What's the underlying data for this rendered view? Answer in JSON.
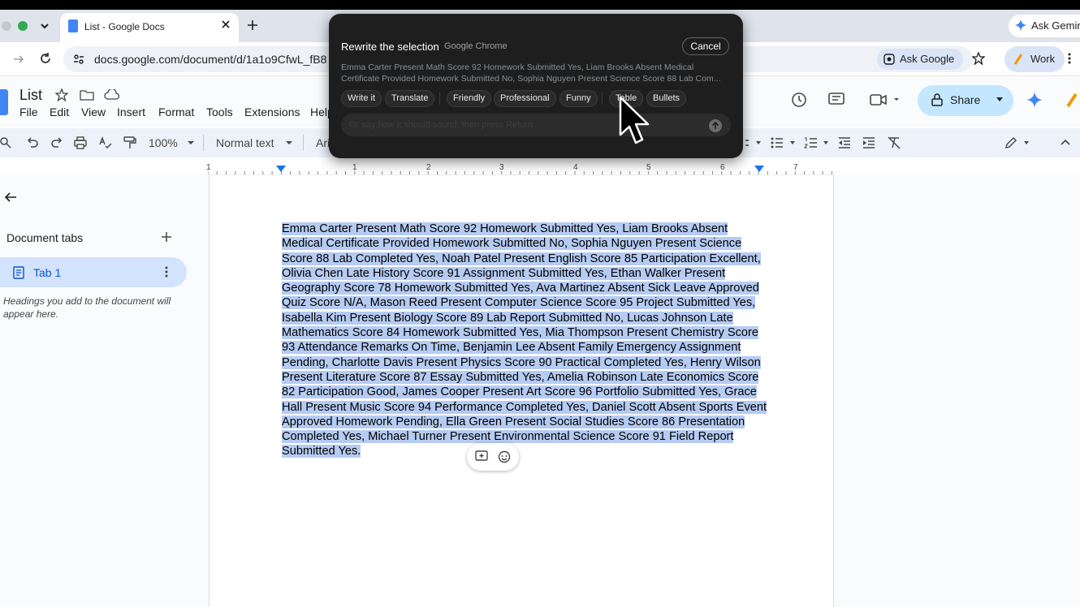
{
  "browser": {
    "tab_title": "List - Google Docs",
    "url": "docs.google.com/document/d/1a1o9CfwL_fB8",
    "ask_gemini": "Ask Gemin",
    "ask_google": "Ask Google",
    "profile": "Work"
  },
  "docs": {
    "title": "List",
    "menu": [
      "File",
      "Edit",
      "View",
      "Insert",
      "Format",
      "Tools",
      "Extensions",
      "Help"
    ],
    "share_label": "Share",
    "toolbar": {
      "zoom": "100%",
      "style": "Normal text",
      "font": "Ari"
    },
    "ruler_numbers": [
      "1",
      "1",
      "2",
      "3",
      "4",
      "5",
      "6",
      "7"
    ]
  },
  "sidebar": {
    "heading": "Document tabs",
    "tab_label": "Tab 1",
    "hint": "Headings you add to the document will appear here."
  },
  "document": {
    "body": "Emma Carter Present Math Score 92 Homework Submitted Yes, Liam Brooks Absent Medical Certificate Provided Homework Submitted No, Sophia Nguyen Present Science Score 88 Lab Completed Yes, Noah Patel Present English Score 85 Participation Excellent, Olivia Chen Late History Score 91 Assignment Submitted Yes, Ethan Walker Present Geography Score 78 Homework Submitted Yes, Ava Martinez Absent Sick Leave Approved Quiz Score N/A, Mason Reed Present Computer Science Score 95 Project Submitted Yes, Isabella Kim Present Biology Score 89 Lab Report Submitted No, Lucas Johnson Late Mathematics Score 84 Homework Submitted Yes, Mia Thompson Present Chemistry Score 93 Attendance Remarks On Time, Benjamin Lee Absent Family Emergency Assignment Pending, Charlotte Davis Present Physics Score 90 Practical Completed Yes, Henry Wilson Present Literature Score 87 Essay Submitted Yes, Amelia Robinson Late Economics Score 82 Participation Good, James Cooper Present Art Score 96 Portfolio Submitted Yes, Grace Hall Present Music Score 94 Performance Completed Yes, Daniel Scott Absent Sports Event Approved Homework Pending, Ella Green Present Social Studies Score 86 Presentation Completed Yes, Michael Turner Present Environmental Science Score 91 Field Report Submitted Yes."
  },
  "rewrite_popup": {
    "title": "Rewrite the selection",
    "source": "Google Chrome",
    "cancel": "Cancel",
    "preview_line1": "Emma Carter Present Math Score 92 Homework Submitted Yes, Liam Brooks Absent Medical",
    "preview_line2": "Certificate Provided Homework Submitted No, Sophia Nguyen Present Science Score 88 Lab Com...",
    "chips": [
      "Write it",
      "Translate",
      "Friendly",
      "Professional",
      "Funny",
      "Table",
      "Bullets"
    ],
    "placeholder": "Or say how it should sound, then press Return"
  },
  "colors": {
    "selection": "#b5cbf2",
    "share_bg": "#c2e7ff",
    "popup_bg": "#1e1e1e",
    "tab_active_bg": "#d3e3fd"
  }
}
